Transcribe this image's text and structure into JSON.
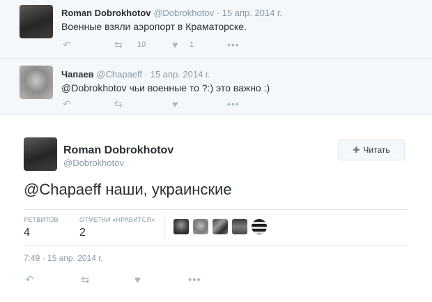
{
  "tweet1": {
    "name": "Roman Dobrokhotov",
    "handle": "@Dobrokhotov",
    "date": "· 15 апр. 2014 г.",
    "text": "Военные взяли аэропорт в Краматорске.",
    "retweets": "10",
    "likes": "1"
  },
  "tweet2": {
    "name": "Чапаев",
    "handle": "@Chapaeff",
    "date": "· 15 апр. 2014 г.",
    "text": "@Dobrokhotov чьи военные то ?:) это важно :)"
  },
  "main": {
    "name": "Roman Dobrokhotov",
    "handle": "@Dobrokhotov",
    "follow_label": "Читать",
    "text": "@Chapaeff наши, украинские",
    "retweets_label": "РЕТВИТОВ",
    "retweets": "4",
    "likes_label": "ОТМЕТКИ «НРАВИТСЯ»",
    "likes": "2",
    "time": "7:49 - 15 апр. 2014 г."
  },
  "icons": {
    "reply": "reply-icon",
    "retweet": "retweet-icon",
    "like": "heart-icon",
    "more": "more-icon",
    "follow": "add-user-icon"
  },
  "colors": {
    "name": "#292f33",
    "muted": "#8899a6",
    "icon": "#aab8c2",
    "divider": "#e1e8ed",
    "conversation_bg": "#f5f8fa"
  }
}
